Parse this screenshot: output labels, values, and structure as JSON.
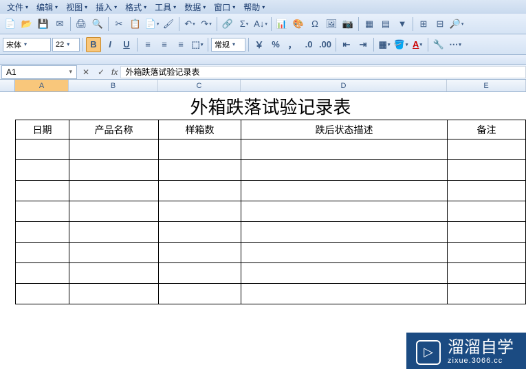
{
  "menu": {
    "file": "文件",
    "edit": "编辑",
    "view": "视图",
    "insert": "插入",
    "format": "格式",
    "tools": "工具",
    "data": "数据",
    "window": "窗口",
    "help": "帮助"
  },
  "fmt": {
    "font": "宋体",
    "size": "22",
    "bold": "B",
    "italic": "I",
    "underline": "U",
    "style": "常规"
  },
  "cell": {
    "ref": "A1",
    "formula": "外箱跌落试验记录表"
  },
  "cols": {
    "A": "A",
    "B": "B",
    "C": "C",
    "D": "D",
    "E": "E"
  },
  "sheet": {
    "title": "外箱跌落试验记录表",
    "headers": {
      "date": "日期",
      "product": "产品名称",
      "boxcount": "样箱数",
      "state": "跌后状态描述",
      "remark": "备注"
    },
    "rows": [
      {
        "date": "",
        "product": "",
        "boxcount": "",
        "state": "",
        "remark": ""
      },
      {
        "date": "",
        "product": "",
        "boxcount": "",
        "state": "",
        "remark": ""
      },
      {
        "date": "",
        "product": "",
        "boxcount": "",
        "state": "",
        "remark": ""
      },
      {
        "date": "",
        "product": "",
        "boxcount": "",
        "state": "",
        "remark": ""
      },
      {
        "date": "",
        "product": "",
        "boxcount": "",
        "state": "",
        "remark": ""
      },
      {
        "date": "",
        "product": "",
        "boxcount": "",
        "state": "",
        "remark": ""
      },
      {
        "date": "",
        "product": "",
        "boxcount": "",
        "state": "",
        "remark": ""
      },
      {
        "date": "",
        "product": "",
        "boxcount": "",
        "state": "",
        "remark": ""
      }
    ]
  },
  "wm": {
    "brand": "溜溜自学",
    "url": "zixue.3066.cc"
  },
  "fx": "fx"
}
